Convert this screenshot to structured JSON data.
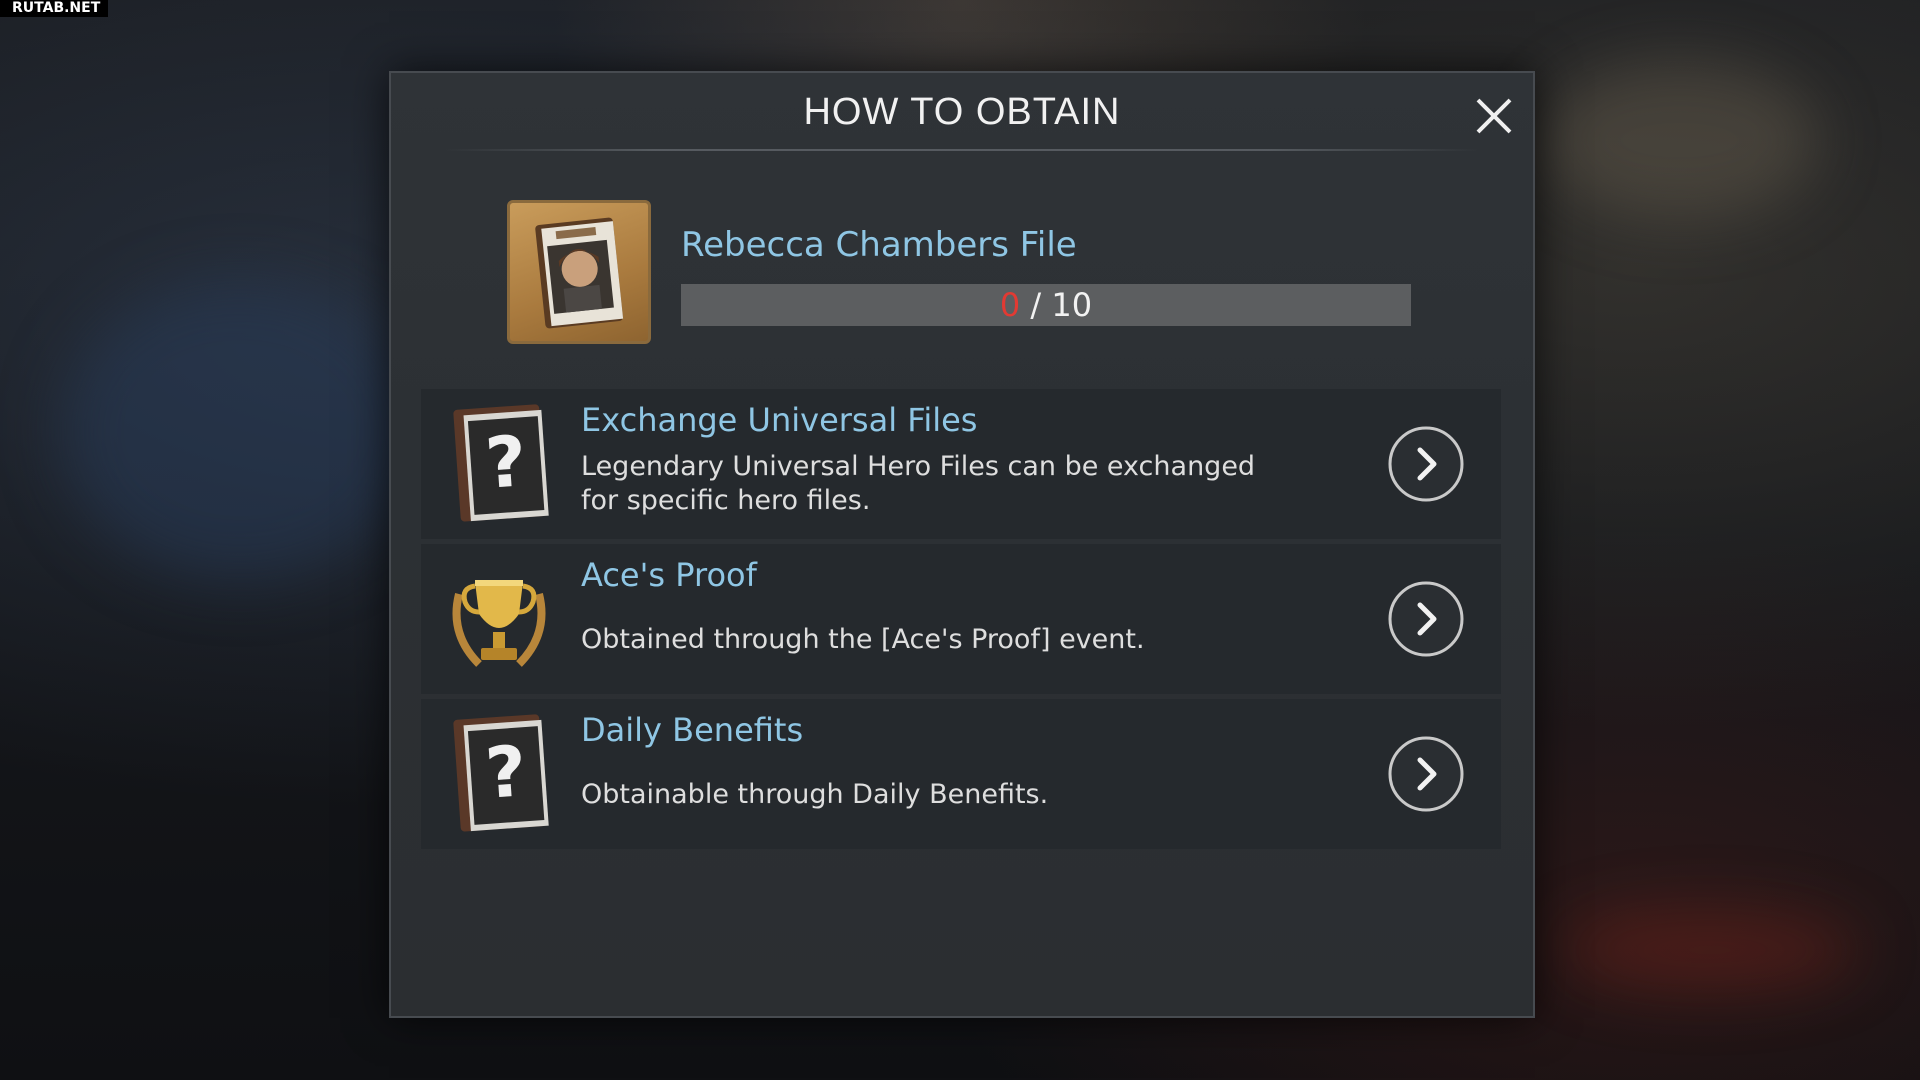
{
  "watermark": "RUTAB.NET",
  "dialog": {
    "title": "HOW TO OBTAIN",
    "item": {
      "name": "Rebecca Chambers File",
      "progress_current": "0",
      "progress_separator": " / ",
      "progress_total": "10",
      "progress_fraction": 0.0
    },
    "sources": [
      {
        "icon": "question-file-icon",
        "title": "Exchange Universal Files",
        "description_line1": "Legendary Universal Hero Files can be exchanged",
        "description_line2": "for specific hero files."
      },
      {
        "icon": "trophy-icon",
        "title": "Ace's Proof",
        "description_line1": "Obtained through the [Ace's Proof] event."
      },
      {
        "icon": "question-file-icon",
        "title": "Daily Benefits",
        "description_line1": "Obtainable through Daily Benefits."
      }
    ]
  },
  "colors": {
    "accent_title": "#8fc6e4",
    "progress_current": "#e23a33"
  }
}
